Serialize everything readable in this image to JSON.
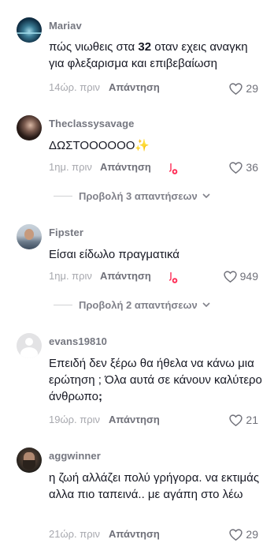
{
  "comments": [
    {
      "username": "Mariav",
      "text_before": "πώς νιωθεις στα ",
      "text_bold": "32",
      "text_after": " οταν εχεις αναγκη για φλεξαρισμα και επιβεβαίωση",
      "time": "14ώρ. πριν",
      "reply_label": "Απάντηση",
      "likes": "29",
      "avatar_icon": "ocean-avatar"
    },
    {
      "username": "Theclassysavage",
      "text": "ΔΩΣΤΟΟΟΟΟΟ✨",
      "time": "1ημ. πριν",
      "reply_label": "Απάντηση",
      "likes": "36",
      "creator_liked": true,
      "view_replies": "Προβολή 3 απαντήσεων",
      "avatar_icon": "woman-avatar"
    },
    {
      "username": "Fipster",
      "text": "Είσαι είδωλο πραγματικά",
      "time": "1ημ. πριν",
      "reply_label": "Απάντηση",
      "likes": "949",
      "creator_liked": true,
      "view_replies": "Προβολή 2 απαντήσεων",
      "avatar_icon": "man-avatar"
    },
    {
      "username": "evans19810",
      "text_before": "Επειδή δεν ξέρω θα ήθελα να κάνω μια ερώτηση ; Όλα αυτά σε κάνουν καλύτερο άνθρωπο",
      "text_bold": ";",
      "text_after": "",
      "time": "19ώρ. πριν",
      "reply_label": "Απάντηση",
      "likes": "21",
      "avatar_icon": "default-avatar"
    },
    {
      "username": "aggwinner",
      "text": "η ζωή αλλάζει πολύ γρήγορα. να εκτιμάς αλλα πιο ταπεινά.. με αγάπη στο λέω",
      "time": "21ώρ. πριν",
      "reply_label": "Απάντηση",
      "likes": "29",
      "avatar_icon": "beard-avatar"
    }
  ],
  "colors": {
    "text": "#161823",
    "muted": "#a7a8ae",
    "username": "#757780",
    "creator_badge": "#fe2c55"
  }
}
